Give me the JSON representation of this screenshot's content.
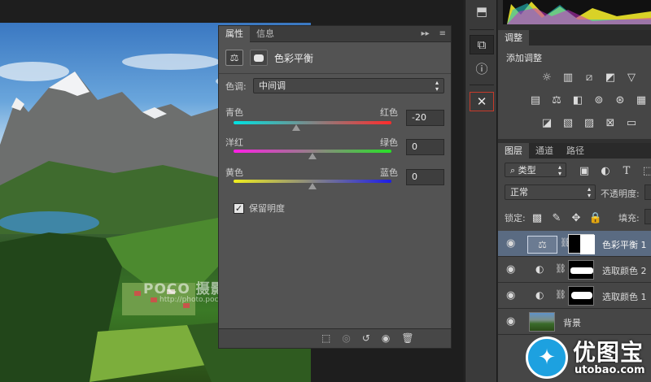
{
  "properties_panel": {
    "tabs": [
      {
        "label": "属性"
      },
      {
        "label": "信息"
      }
    ],
    "title": "色彩平衡",
    "tone_label": "色调:",
    "tone_value": "中间调",
    "sliders": [
      {
        "left": "青色",
        "right": "红色",
        "value": "-20",
        "position": 0.4
      },
      {
        "left": "洋红",
        "right": "绿色",
        "value": "0",
        "position": 0.5
      },
      {
        "left": "黄色",
        "right": "蓝色",
        "value": "0",
        "position": 0.5
      }
    ],
    "preserve_luminosity_label": "保留明度",
    "preserve_luminosity_checked": true
  },
  "adjustments_panel": {
    "tab": "调整",
    "title": "添加调整"
  },
  "layers_panel": {
    "tabs": [
      {
        "label": "图层"
      },
      {
        "label": "通道"
      },
      {
        "label": "路径"
      }
    ],
    "filter_label": "类型",
    "blend_mode": "正常",
    "opacity_label": "不透明度:",
    "lock_label": "锁定:",
    "fill_label": "填充:",
    "layers": [
      {
        "name": "色彩平衡 1",
        "selected": true
      },
      {
        "name": "选取颜色 2",
        "selected": false
      },
      {
        "name": "选取颜色 1",
        "selected": false
      },
      {
        "name": "背景",
        "selected": false
      }
    ]
  },
  "watermarks": {
    "poco_main": "POCO 摄影专题",
    "poco_url": "http://photo.poco.cn/",
    "utobao_cn": "优图宝",
    "utobao_url": "utobao.com"
  },
  "colors": {
    "panel_bg": "#535353",
    "dark_bg": "#262626",
    "highlight": "#5a6b82",
    "accent_red": "#d23b2b"
  }
}
